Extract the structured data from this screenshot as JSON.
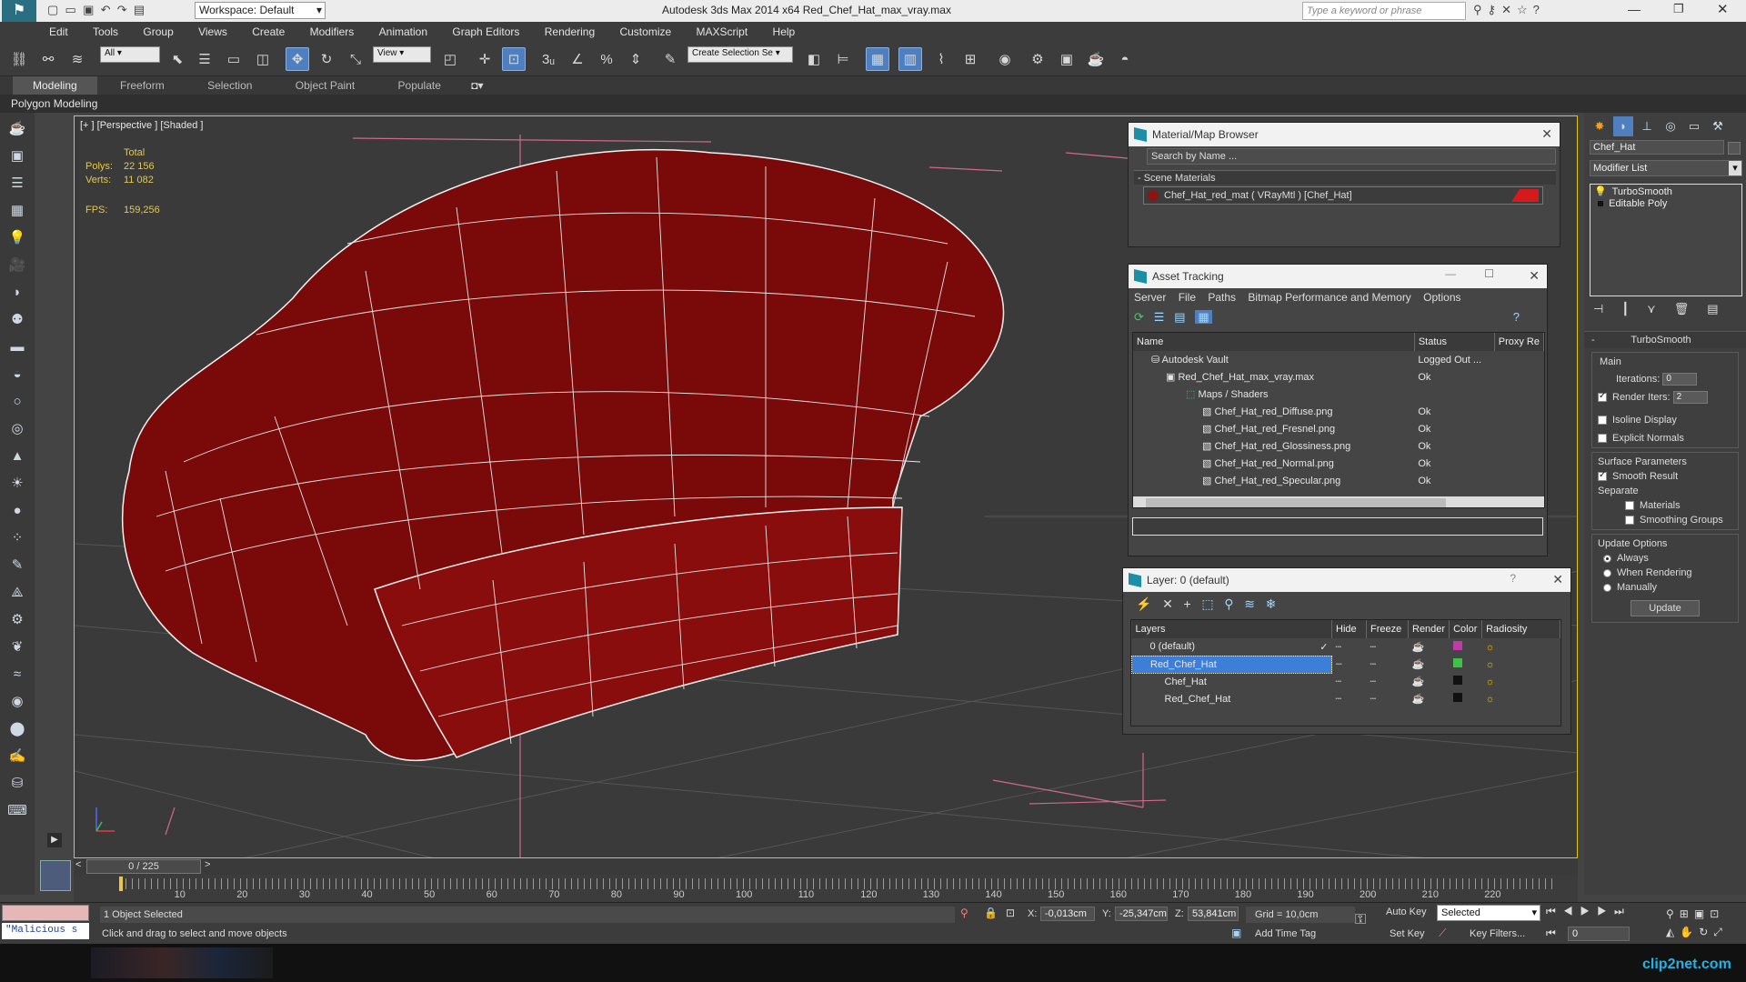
{
  "titlebar": {
    "workspace": "Workspace: Default",
    "title": "Autodesk 3ds Max  2014 x64     Red_Chef_Hat_max_vray.max",
    "search_placeholder": "Type a keyword or phrase"
  },
  "menus": [
    "Edit",
    "Tools",
    "Group",
    "Views",
    "Create",
    "Modifiers",
    "Animation",
    "Graph Editors",
    "Rendering",
    "Customize",
    "MAXScript",
    "Help"
  ],
  "toolbar": {
    "filter": "All",
    "refcoord": "View",
    "selection_set": "Create Selection Se"
  },
  "ribbon": {
    "tabs": [
      "Modeling",
      "Freeform",
      "Selection",
      "Object Paint",
      "Populate"
    ],
    "sub": "Polygon Modeling"
  },
  "viewport": {
    "label": "[+ ] [Perspective ] [Shaded ]",
    "stats_header": "Total",
    "polys_label": "Polys:",
    "polys": "22 156",
    "verts_label": "Verts:",
    "verts": "11 082",
    "fps_label": "FPS:",
    "fps": "159,256",
    "object_color": "#7a0a0a"
  },
  "material_browser": {
    "title": "Material/Map Browser",
    "search": "Search by Name ...",
    "section": "- Scene Materials",
    "item": "Chef_Hat_red_mat  ( VRayMtl )  [Chef_Hat]"
  },
  "asset_tracking": {
    "title": "Asset Tracking",
    "menus": [
      "Server",
      "File",
      "Paths",
      "Bitmap Performance and Memory",
      "Options"
    ],
    "columns": [
      "Name",
      "Status",
      "Proxy Re"
    ],
    "rows": [
      {
        "name": "Autodesk Vault",
        "status": "Logged Out ..."
      },
      {
        "name": "Red_Chef_Hat_max_vray.max",
        "status": "Ok"
      },
      {
        "name": "Maps / Shaders",
        "status": ""
      },
      {
        "name": "Chef_Hat_red_Diffuse.png",
        "status": "Ok"
      },
      {
        "name": "Chef_Hat_red_Fresnel.png",
        "status": "Ok"
      },
      {
        "name": "Chef_Hat_red_Glossiness.png",
        "status": "Ok"
      },
      {
        "name": "Chef_Hat_red_Normal.png",
        "status": "Ok"
      },
      {
        "name": "Chef_Hat_red_Specular.png",
        "status": "Ok"
      }
    ]
  },
  "layers": {
    "title": "Layer: 0 (default)",
    "columns": [
      "Layers",
      "Hide",
      "Freeze",
      "Render",
      "Color",
      "Radiosity"
    ],
    "rows": [
      {
        "name": "0 (default)",
        "color": "#c03aa8"
      },
      {
        "name": "Red_Chef_Hat",
        "color": "#3ec24a"
      },
      {
        "name": "Chef_Hat",
        "color": "#111111"
      },
      {
        "name": "Red_Chef_Hat",
        "color": "#111111"
      }
    ]
  },
  "command_panel": {
    "object_name": "Chef_Hat",
    "modifier_list": "Modifier List",
    "stack": [
      "TurboSmooth",
      "Editable Poly"
    ],
    "turbosmooth": {
      "title": "TurboSmooth",
      "main": "Main",
      "iterations_label": "Iterations:",
      "iterations": "0",
      "render_iters_label": "Render Iters:",
      "render_iters": "2",
      "isoline": "Isoline Display",
      "explicit": "Explicit Normals",
      "surface": "Surface Parameters",
      "smooth": "Smooth Result",
      "separate": "Separate",
      "materials": "Materials",
      "smoothing": "Smoothing Groups",
      "update_options": "Update Options",
      "always": "Always",
      "when_rendering": "When Rendering",
      "manually": "Manually",
      "update": "Update"
    }
  },
  "timeline": {
    "frame": "0 / 225",
    "ticks": [
      "10",
      "20",
      "30",
      "40",
      "50",
      "60",
      "70",
      "80",
      "90",
      "100",
      "110",
      "120",
      "130",
      "140",
      "150",
      "160",
      "170",
      "180",
      "190",
      "200",
      "210",
      "220"
    ]
  },
  "status": {
    "maxscript": "\"Malicious s",
    "selected": "1 Object Selected",
    "prompt": "Click and drag to select and move objects",
    "x_label": "X:",
    "x": "-0,013cm",
    "y_label": "Y:",
    "y": "-25,347cm",
    "z_label": "Z:",
    "z": "53,841cm",
    "grid": "Grid = 10,0cm",
    "add_time_tag": "Add Time Tag",
    "auto_key": "Auto Key",
    "set_key": "Set Key",
    "key_mode": "Selected",
    "key_filters": "Key Filters...",
    "frame_field": "0"
  },
  "watermark": "clip2net.com"
}
